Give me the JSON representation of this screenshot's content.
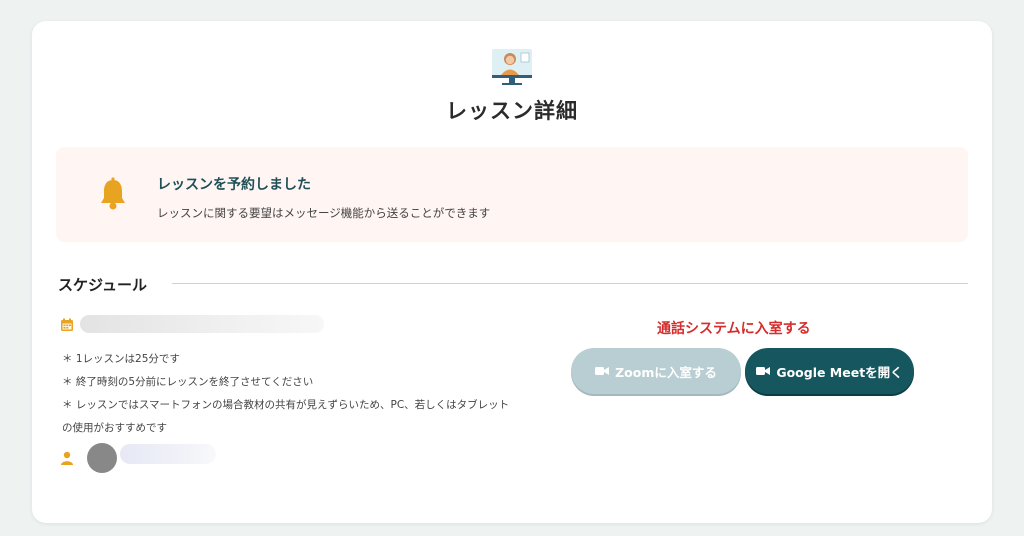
{
  "page": {
    "title": "レッスン詳細",
    "hero_icon": "teacher-monitor-icon"
  },
  "notice": {
    "icon": "bell-icon",
    "title": "レッスンを予約しました",
    "text": "レッスンに関する要望はメッセージ機能から送ることができます"
  },
  "schedule": {
    "section_title": "スケジュール",
    "date_icon": "calendar-icon",
    "notes": [
      "＊ 1レッスンは25分です",
      "＊ 終了時刻の5分前にレッスンを終了させてください",
      "＊ レッスンではスマートフォンの場合教材の共有が見えずらいため、PC、若しくはタブレットの使用がおすすめです"
    ],
    "user_icon": "user-icon"
  },
  "call": {
    "heading": "通話システムに入室する",
    "zoom_label": "Zoomに入室する",
    "meet_label": "Google Meetを開く"
  },
  "colors": {
    "accent": "#16575f",
    "alert": "#d62c2c",
    "icon_orange": "#e8a321",
    "notice_bg": "#fff5f3"
  }
}
